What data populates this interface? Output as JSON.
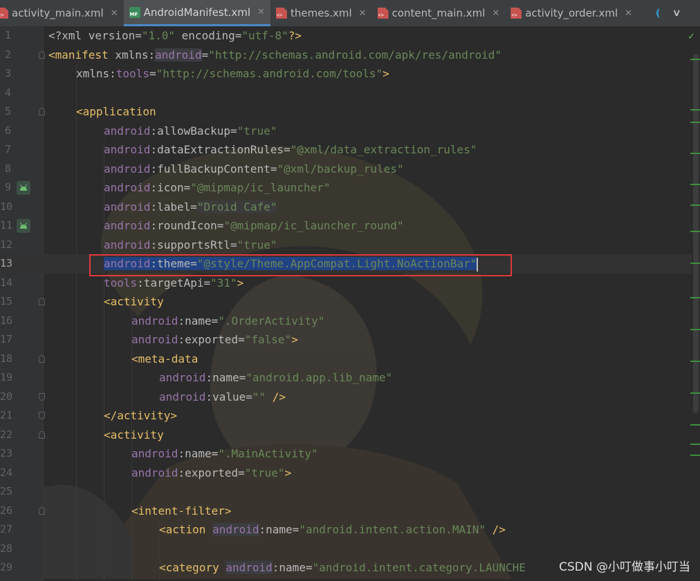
{
  "tabs": [
    {
      "label": "activity_main.xml",
      "icon": "xml-file-icon",
      "active": false
    },
    {
      "label": "AndroidManifest.xml",
      "icon": "manifest-file-icon",
      "active": true
    },
    {
      "label": "themes.xml",
      "icon": "xml-file-icon",
      "active": false
    },
    {
      "label": "content_main.xml",
      "icon": "xml-file-icon",
      "active": false
    },
    {
      "label": "activity_order.xml",
      "icon": "xml-file-icon",
      "active": false
    }
  ],
  "editor": {
    "current_line": 13,
    "inspection_status_icon": "check-mark-icon",
    "lines": [
      {
        "n": "1"
      },
      {
        "n": "2"
      },
      {
        "n": "3"
      },
      {
        "n": "4"
      },
      {
        "n": "5"
      },
      {
        "n": "6"
      },
      {
        "n": "7"
      },
      {
        "n": "8"
      },
      {
        "n": "9"
      },
      {
        "n": "10"
      },
      {
        "n": "11"
      },
      {
        "n": "12"
      },
      {
        "n": "13"
      },
      {
        "n": "14"
      },
      {
        "n": "15"
      },
      {
        "n": "16"
      },
      {
        "n": "17"
      },
      {
        "n": "18"
      },
      {
        "n": "19"
      },
      {
        "n": "20"
      },
      {
        "n": "21"
      },
      {
        "n": "22"
      },
      {
        "n": "23"
      },
      {
        "n": "24"
      },
      {
        "n": "25"
      },
      {
        "n": "26"
      },
      {
        "n": "27"
      },
      {
        "n": "28"
      },
      {
        "n": "29"
      }
    ],
    "code": {
      "l1": {
        "decl": "<?xml version=",
        "ver": "\"1.0\"",
        "enc": " encoding=",
        "encv": "\"utf-8\"",
        "end": "?>"
      },
      "l2": {
        "tag": "<manifest",
        "attr": " xmlns:",
        "ns": "android",
        "eq": "=",
        "val": "\"http://schemas.android.com/apk/res/android\""
      },
      "l3": {
        "attr": "xmlns:",
        "ns": "tools",
        "eq": "=",
        "val": "\"http://schemas.android.com/tools\"",
        "end": ">"
      },
      "l5": {
        "tag": "<application"
      },
      "l6": {
        "ns": "android",
        "attr": ":allowBackup=",
        "val": "\"true\""
      },
      "l7": {
        "ns": "android",
        "attr": ":dataExtractionRules=",
        "val": "\"@xml/data_extraction_rules\""
      },
      "l8": {
        "ns": "android",
        "attr": ":fullBackupContent=",
        "val": "\"@xml/backup_rules\""
      },
      "l9": {
        "ns": "android",
        "attr": ":icon=",
        "val": "\"@mipmap/ic_launcher\""
      },
      "l10": {
        "ns": "android",
        "attr": ":label=",
        "val": "\"Droid Cafe\""
      },
      "l11": {
        "ns": "android",
        "attr": ":roundIcon=",
        "val": "\"@mipmap/ic_launcher_round\""
      },
      "l12": {
        "ns": "android",
        "attr": ":supportsRtl=",
        "val": "\"true\""
      },
      "l13": {
        "ns": "android",
        "attr": ":theme=",
        "val": "\"@style/Theme.AppCompat.Light.NoActionBar\""
      },
      "l14": {
        "ns": "tools",
        "attr": ":targetApi=",
        "val": "\"31\"",
        "end": ">"
      },
      "l15": {
        "tag": "<activity"
      },
      "l16": {
        "ns": "android",
        "attr": ":name=",
        "val": "\".OrderActivity\""
      },
      "l17": {
        "ns": "android",
        "attr": ":exported=",
        "val": "\"false\"",
        "end": ">"
      },
      "l18": {
        "tag": "<meta-data"
      },
      "l19": {
        "ns": "android",
        "attr": ":name=",
        "val": "\"android.app.lib_name\""
      },
      "l20": {
        "ns": "android",
        "attr": ":value=",
        "val": "\"\"",
        "end": " />"
      },
      "l21": {
        "tag": "</activity>"
      },
      "l22": {
        "tag": "<activity"
      },
      "l23": {
        "ns": "android",
        "attr": ":name=",
        "val": "\".MainActivity\""
      },
      "l24": {
        "ns": "android",
        "attr": ":exported=",
        "val": "\"true\"",
        "end": ">"
      },
      "l26": {
        "tag": "<intent-filter>"
      },
      "l27": {
        "tag": "<action",
        "ns": "android",
        "attr": ":name=",
        "val": "\"android.intent.action.MAIN\"",
        "end": " />"
      },
      "l29": {
        "tag": "<category",
        "ns": "android",
        "attr": ":name=",
        "val": "\"android.intent.category.LAUNCHE"
      }
    }
  },
  "watermark": "CSDN @小叮做事小叮当"
}
